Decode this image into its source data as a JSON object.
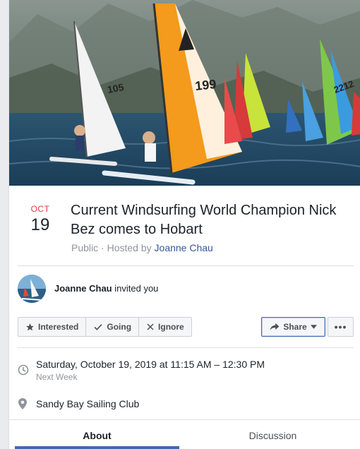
{
  "event": {
    "month": "OCT",
    "day": "19",
    "title": "Current Windsurfing World Champion Nick Bez comes to Hobart",
    "privacy": "Public",
    "hosted_by_prefix": "Hosted by",
    "host": "Joanne Chau"
  },
  "invite": {
    "name": "Joanne Chau",
    "text": "invited you"
  },
  "actions": {
    "interested": "Interested",
    "going": "Going",
    "ignore": "Ignore",
    "share": "Share",
    "more": "•••"
  },
  "details": {
    "datetime": "Saturday, October 19, 2019 at 11:15 AM – 12:30 PM",
    "relative": "Next Week",
    "location": "Sandy Bay Sailing Club"
  },
  "tabs": [
    {
      "label": "About",
      "active": true
    },
    {
      "label": "Discussion",
      "active": false
    }
  ],
  "sail_numbers": [
    "105",
    "199",
    "2212"
  ],
  "colors": {
    "accent": "#4267b2",
    "link": "#365899",
    "month": "#e33a3a",
    "muted": "#90949c"
  },
  "icons": {
    "interested": "star-icon",
    "going": "check-icon",
    "ignore": "x-icon",
    "share": "share-arrow-icon",
    "time": "clock-icon",
    "location": "map-pin-icon"
  }
}
